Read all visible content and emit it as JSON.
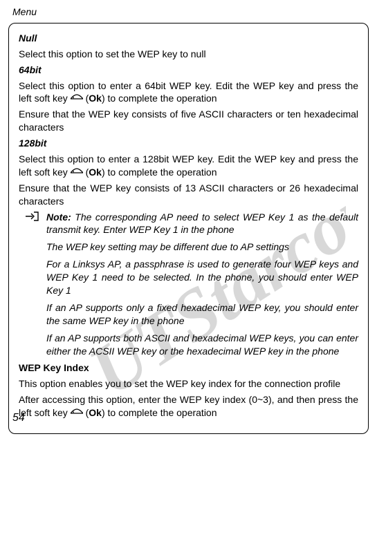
{
  "header": {
    "title": "Menu"
  },
  "sections": {
    "null": {
      "heading": "Null",
      "text": "Select this option to set the WEP key to null"
    },
    "bit64": {
      "heading": "64bit",
      "pre": "Select this option to enter a 64bit WEP key. Edit the WEP key and press the left soft key ",
      "ok_open": " (",
      "ok_label": "Ok",
      "post": ") to complete the operation",
      "ensure": "Ensure that the WEP key consists of five ASCII characters or ten hexadecimal characters"
    },
    "bit128": {
      "heading": "128bit",
      "pre": "Select this option to enter a 128bit WEP key. Edit the WEP key and press the left soft key ",
      "ok_open": " (",
      "ok_label": "Ok",
      "post": ") to complete the operation",
      "ensure": "Ensure that the WEP key consists of 13 ASCII characters or 26 hexadecimal characters"
    }
  },
  "note": {
    "label": "Note:",
    "p1_rest": " The corresponding AP need to select WEP Key 1 as the default transmit key. Enter WEP Key 1 in the phone",
    "p2": "The WEP key setting may be different due to AP settings",
    "p3": "For a Linksys AP, a passphrase is used to generate four WEP keys and WEP Key 1 need to be selected. In the phone, you should enter WEP Key 1",
    "p4": "If an AP supports only a fixed hexadecimal WEP key, you should enter the same WEP key in the phone",
    "p5": "If an AP supports both ASCII and hexadecimal WEP keys, you can enter either the ACSII WEP key or the hexadecimal WEP key in the phone"
  },
  "wep_index": {
    "heading": "WEP Key Index",
    "p1": "This option enables you to set the WEP key index for the connection profile",
    "p2_pre": "After accessing this option, enter the WEP key index (0~3), and then press the left soft key ",
    "ok_open": " (",
    "ok_label": "Ok",
    "p2_post": ") to complete the operation"
  },
  "page_number": "54"
}
